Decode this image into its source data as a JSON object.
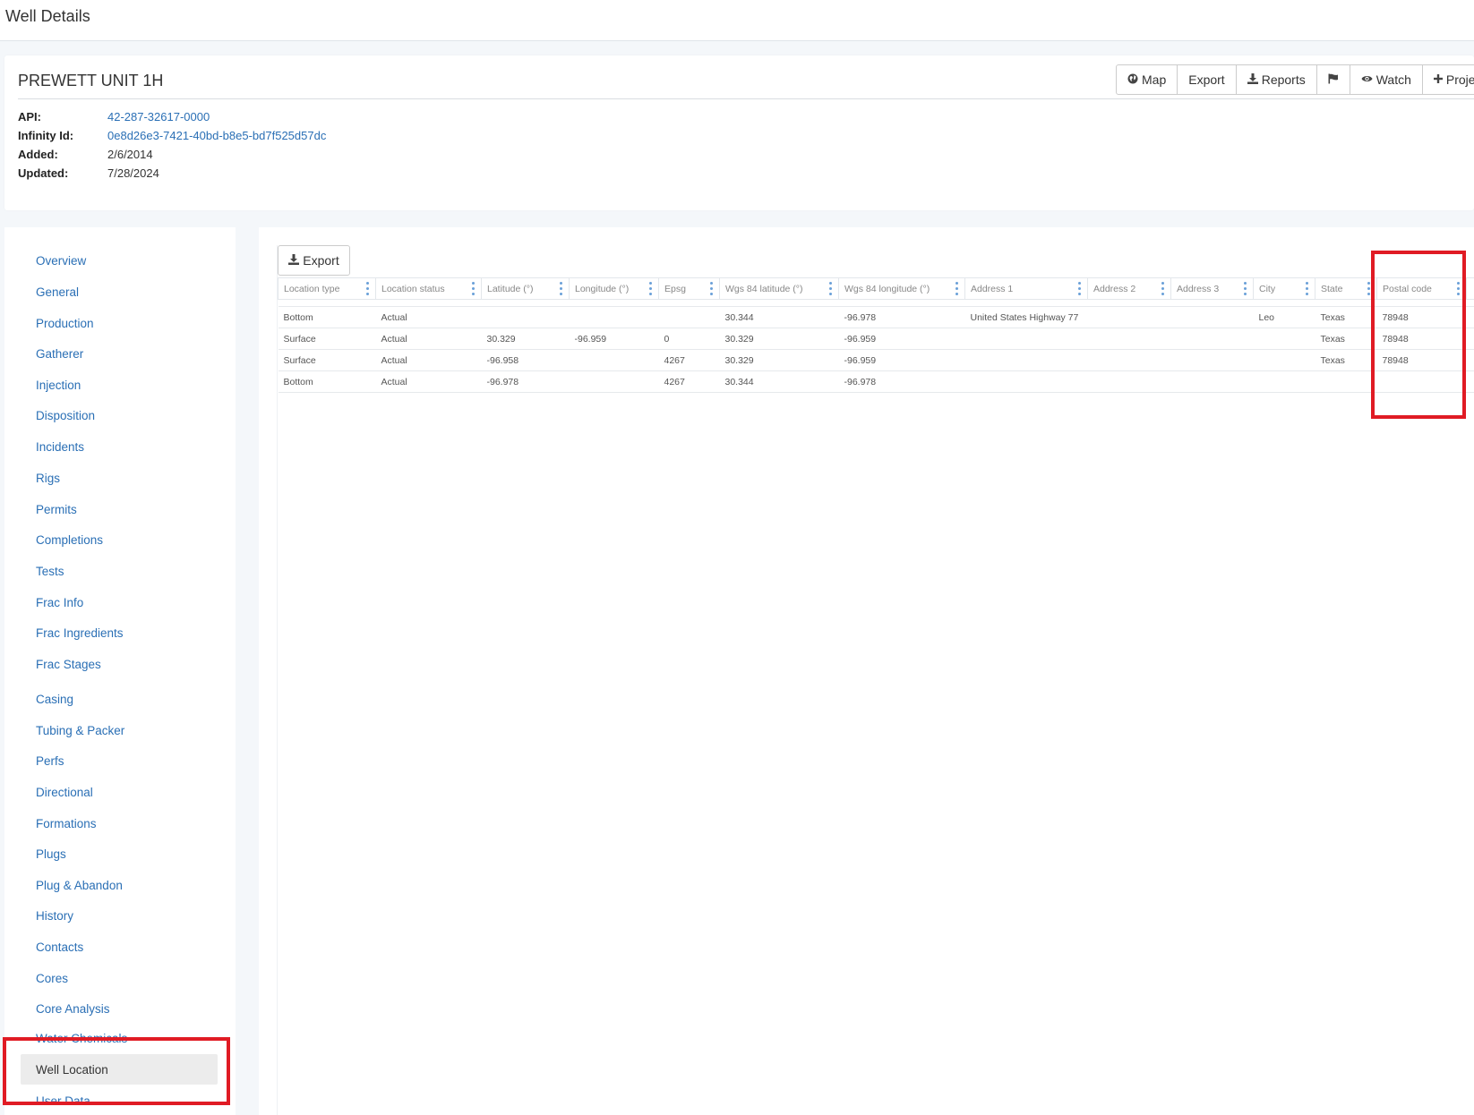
{
  "page": {
    "title": "Well Details"
  },
  "well": {
    "name": "PREWETT UNIT 1H",
    "fields": [
      {
        "label": "API:",
        "value": "42-287-32617-0000"
      },
      {
        "label": "Infinity Id:",
        "value": "0e8d26e3-7421-40bd-b8e5-bd7f525d57dc"
      },
      {
        "label": "Added:",
        "value": "2/6/2014"
      },
      {
        "label": "Updated:",
        "value": "7/28/2024"
      }
    ]
  },
  "toolbar": {
    "map_label": "Map",
    "export_label": "Export",
    "reports_label": "Reports",
    "watch_label": "Watch",
    "project_label": "Projec"
  },
  "sidebar": {
    "items": [
      {
        "label": "Overview"
      },
      {
        "label": "General"
      },
      {
        "label": "Production"
      },
      {
        "label": "Gatherer"
      },
      {
        "label": "Injection"
      },
      {
        "label": "Disposition"
      },
      {
        "label": "Incidents"
      },
      {
        "label": "Rigs"
      },
      {
        "label": "Permits"
      },
      {
        "label": "Completions"
      },
      {
        "label": "Tests"
      },
      {
        "label": "Frac Info"
      },
      {
        "label": "Frac Ingredients"
      },
      {
        "label": "Frac Stages"
      },
      {
        "label": "Casing"
      },
      {
        "label": "Tubing & Packer"
      },
      {
        "label": "Perfs"
      },
      {
        "label": "Directional"
      },
      {
        "label": "Formations"
      },
      {
        "label": "Plugs"
      },
      {
        "label": "Plug & Abandon"
      },
      {
        "label": "History"
      },
      {
        "label": "Contacts"
      },
      {
        "label": "Cores"
      },
      {
        "label": "Core Analysis"
      },
      {
        "label": "Water Chemicals"
      },
      {
        "label": "Well Location"
      },
      {
        "label": "User Data"
      }
    ],
    "active": "Well Location"
  },
  "main": {
    "export_label": "Export",
    "columns": [
      "Location type",
      "Location status",
      "Latitude (°)",
      "Longitude (°)",
      "Epsg",
      "Wgs 84 latitude (°)",
      "Wgs 84 longitude (°)",
      "Address 1",
      "Address 2",
      "Address 3",
      "City",
      "State",
      "Postal code"
    ],
    "rows": [
      [
        "Bottom",
        "Actual",
        "",
        "",
        "",
        "30.344",
        "-96.978",
        "United States Highway 77",
        "",
        "",
        "Leo",
        "Texas",
        "78948"
      ],
      [
        "Surface",
        "Actual",
        "30.329",
        "-96.959",
        "0",
        "30.329",
        "-96.959",
        "",
        "",
        "",
        "",
        "Texas",
        "78948"
      ],
      [
        "Surface",
        "Actual",
        "-96.958",
        "",
        "4267",
        "30.329",
        "-96.959",
        "",
        "",
        "",
        "",
        "Texas",
        "78948"
      ],
      [
        "Bottom",
        "Actual",
        "-96.978",
        "",
        "4267",
        "30.344",
        "-96.978",
        "",
        "",
        "",
        "",
        "",
        ""
      ]
    ]
  },
  "colors": {
    "link": "#2a6fb5",
    "highlight": "#e01b24",
    "active_nav_bg": "#ececec"
  }
}
